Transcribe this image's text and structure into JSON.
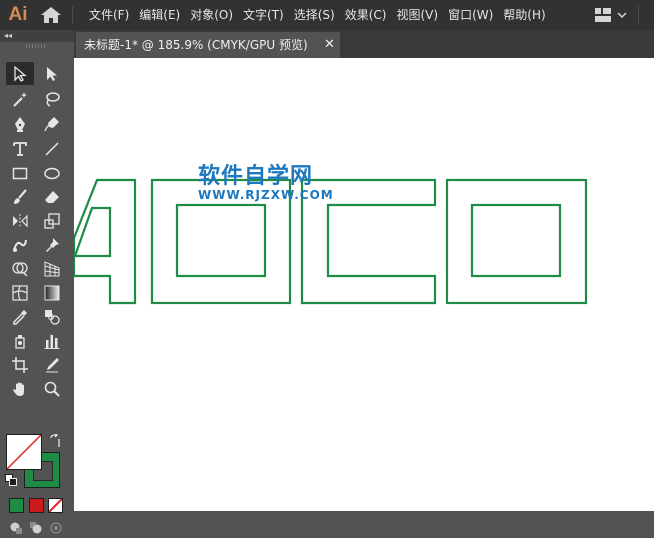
{
  "app": {
    "logo": "Ai"
  },
  "menu": [
    "文件(F)",
    "编辑(E)",
    "对象(O)",
    "文字(T)",
    "选择(S)",
    "效果(C)",
    "视图(V)",
    "窗口(W)",
    "帮助(H)"
  ],
  "panel": {
    "collapse_glyph": "◂◂"
  },
  "document_tab": {
    "label": "未标题-1* @ 185.9% (CMYK/GPU 预览)",
    "close": "✕"
  },
  "watermark": {
    "chinese": "软件自学网",
    "url": "WWW.RJZXW.COM"
  },
  "colors": {
    "outline": "#1e8c45",
    "watermark": "#1d78bf",
    "fill_swatch": "#ffffff",
    "stroke_swatch": "#1e8c45"
  }
}
